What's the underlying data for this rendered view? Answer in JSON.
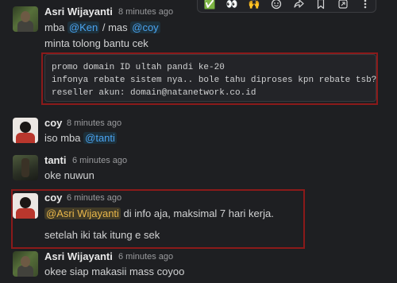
{
  "toolbar": {
    "actions": [
      {
        "icon": "check-mark-reaction-icon",
        "glyph": "✅"
      },
      {
        "icon": "eyes-reaction-icon",
        "glyph": "👀"
      },
      {
        "icon": "raised-hands-reaction-icon",
        "glyph": "🙌"
      },
      {
        "icon": "add-reaction-icon"
      },
      {
        "icon": "forward-icon"
      },
      {
        "icon": "bookmark-icon"
      },
      {
        "icon": "shortcut-icon"
      },
      {
        "icon": "more-actions-icon"
      }
    ]
  },
  "messages": [
    {
      "author": "Asri Wijayanti",
      "time": "8 minutes ago",
      "avatar": "asri-avatar",
      "line1": {
        "prefix": "mba ",
        "mention1": "@Ken",
        "middle": " / mas ",
        "mention2": "@coy"
      },
      "line2": "minta tolong bantu cek",
      "code_lines": [
        "promo domain ID ultah pandi ke-20",
        "infonya rebate sistem nya.. bole tahu diproses kpn rebate tsb?",
        "reseller akun: domain@natanetwork.co.id"
      ]
    },
    {
      "author": "coy",
      "time": "8 minutes ago",
      "avatar": "coy-avatar",
      "line1": {
        "prefix": "iso mba ",
        "mention": "@tanti"
      }
    },
    {
      "author": "tanti",
      "time": "6 minutes ago",
      "avatar": "tanti-avatar",
      "text": "oke nuwun"
    },
    {
      "author": "coy",
      "time": "6 minutes ago",
      "avatar": "coy-avatar",
      "line1": {
        "mention": "@Asri Wijayanti",
        "suffix": " di info aja, maksimal 7 hari kerja."
      },
      "line2": "setelah iki tak itung e sek"
    },
    {
      "author": "Asri Wijayanti",
      "time": "6 minutes ago",
      "avatar": "asri-avatar",
      "text": "okee siap makasii mass coyoo"
    }
  ],
  "colors": {
    "background": "#1e1f22",
    "mention": "#4aa3f0",
    "self_mention": "#e8b64a",
    "highlight_border": "#8b1a1a"
  }
}
